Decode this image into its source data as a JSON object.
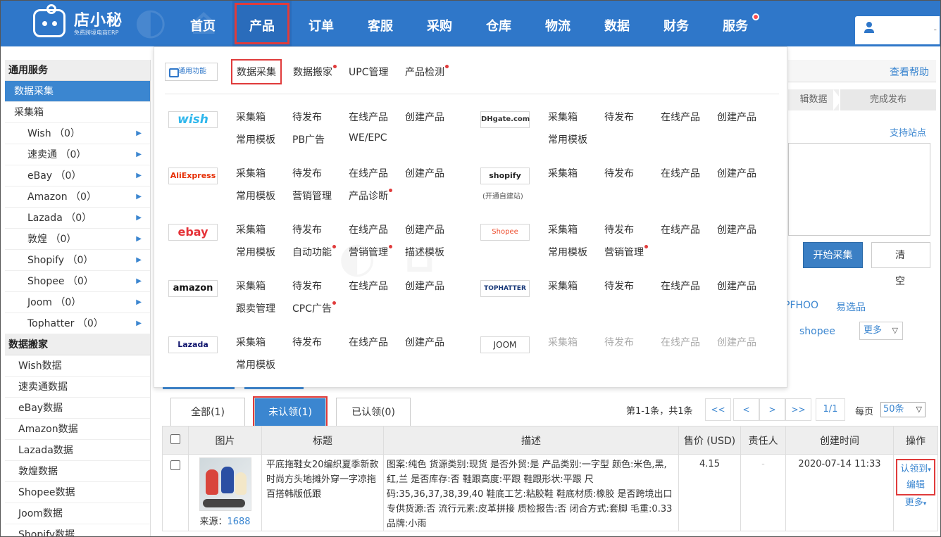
{
  "logo": {
    "name": "店小秘",
    "subtitle": "免费跨境电商ERP"
  },
  "nav": {
    "items": [
      "首页",
      "产品",
      "订单",
      "客服",
      "采购",
      "仓库",
      "物流",
      "数据",
      "财务",
      "服务"
    ],
    "active": "产品",
    "badge_on": "服务"
  },
  "user": {
    "placeholder": "-"
  },
  "sidebar": {
    "section1": "通用服务",
    "items1": [
      "数据采集",
      "采集箱"
    ],
    "sub_items": [
      "Wish （0）",
      "速卖通 （0）",
      "eBay （0）",
      "Amazon （0）",
      "Lazada （0）",
      "敦煌 （0）",
      "Shopify （0）",
      "Shopee （0）",
      "Joom （0）",
      "Tophatter （0）"
    ],
    "section2": "数据搬家",
    "items2": [
      "Wish数据",
      "速卖通数据",
      "eBay数据",
      "Amazon数据",
      "Lazada数据",
      "敦煌数据",
      "Shopee数据",
      "Joom数据",
      "Shopify数据"
    ]
  },
  "dropdown": {
    "general_label": "通用功能",
    "general_tabs": [
      "数据采集",
      "数据搬家",
      "UPC管理",
      "产品检测"
    ],
    "left_platforms": [
      {
        "name": "wish",
        "links": [
          "采集箱",
          "待发布",
          "在线产品",
          "创建产品",
          "常用模板",
          "PB广告",
          "WE/EPC"
        ]
      },
      {
        "name": "AliExpress",
        "links": [
          "采集箱",
          "待发布",
          "在线产品",
          "创建产品",
          "常用模板",
          "营销管理",
          "产品诊断"
        ]
      },
      {
        "name": "ebay",
        "links": [
          "采集箱",
          "待发布",
          "在线产品",
          "创建产品",
          "常用模板",
          "自动功能",
          "营销管理",
          "描述模板"
        ]
      },
      {
        "name": "amazon",
        "links": [
          "采集箱",
          "待发布",
          "在线产品",
          "创建产品",
          "跟卖管理",
          "CPC广告"
        ]
      },
      {
        "name": "Lazada",
        "links": [
          "采集箱",
          "待发布",
          "在线产品",
          "创建产品",
          "常用模板"
        ]
      }
    ],
    "right_platforms": [
      {
        "name": "DHgate.com",
        "links": [
          "采集箱",
          "待发布",
          "在线产品",
          "创建产品",
          "常用模板"
        ]
      },
      {
        "name": "shopify",
        "note": "(开通自建站)",
        "links": [
          "采集箱",
          "待发布",
          "在线产品",
          "创建产品"
        ]
      },
      {
        "name": "Shopee",
        "links": [
          "采集箱",
          "待发布",
          "在线产品",
          "创建产品",
          "常用模板",
          "营销管理"
        ]
      },
      {
        "name": "TOPHATTER",
        "links": [
          "采集箱",
          "待发布",
          "在线产品",
          "创建产品"
        ]
      },
      {
        "name": "JOOM",
        "links": [
          "采集箱",
          "待发布",
          "在线产品",
          "创建产品"
        ]
      }
    ]
  },
  "right_panel": {
    "help": "查看帮助",
    "step1": "辑数据",
    "step2": "完成发布",
    "support": "支持站点",
    "start_btn": "开始采集",
    "clear_btn": "清空",
    "site1": "PFHOO",
    "site2": "易选品",
    "site3": "shopee",
    "more": "更多"
  },
  "list": {
    "tabs": [
      "全部(1)",
      "未认领(1)",
      "已认领(0)"
    ],
    "pager_info": "第1-1条，共1条",
    "pager_btns": [
      "<<",
      "<",
      ">",
      ">>"
    ],
    "page_total": "1/1",
    "per_page_label": "每页",
    "per_page": "50条",
    "columns": [
      "图片",
      "标题",
      "描述",
      "售价 (USD)",
      "责任人",
      "创建时间",
      "操作"
    ],
    "row": {
      "source_label": "来源：",
      "source": "1688",
      "title": "平底拖鞋女20编织夏季新款时尚方头地摊外穿一字凉拖百搭韩版低跟",
      "desc": "图案:纯色 货源类别:现货 是否外贸:是 产品类别:一字型 颜色:米色,黑,红,兰 是否库存:否 鞋跟高度:平跟 鞋跟形状:平跟 尺码:35,36,37,38,39,40 鞋底工艺:粘胶鞋 鞋底材质:橡胶 是否跨境出口专供货源:否 流行元素:皮革拼接 质检报告:否 闭合方式:套脚 毛重:0.33 品牌:小雨",
      "price": "4.15",
      "owner": "-",
      "created": "2020-07-14 11:33",
      "op1": "认领到",
      "op2": "编辑",
      "op3": "更多"
    }
  }
}
